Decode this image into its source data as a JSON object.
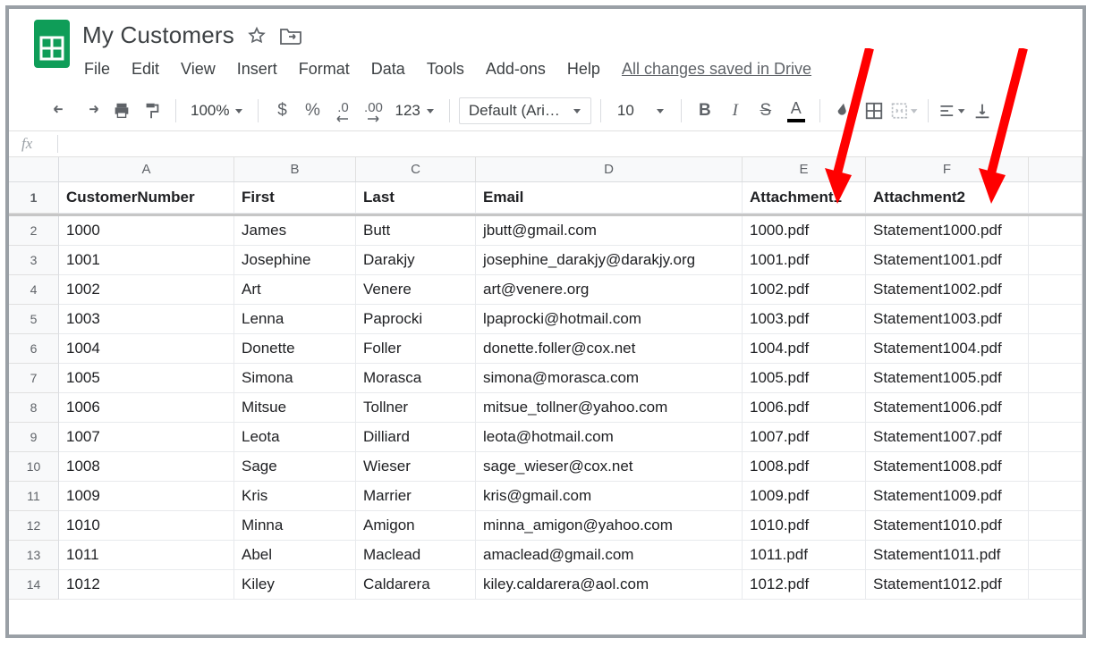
{
  "doc": {
    "title": "My Customers",
    "saved_text": "All changes saved in Drive"
  },
  "menu": {
    "file": "File",
    "edit": "Edit",
    "view": "View",
    "insert": "Insert",
    "format": "Format",
    "data": "Data",
    "tools": "Tools",
    "addons": "Add-ons",
    "help": "Help"
  },
  "toolbar": {
    "zoom": "100%",
    "currency": "$",
    "percent": "%",
    "dec_dec": ".0",
    "inc_dec": ".00",
    "num_format": "123",
    "font_name": "Default (Ari…",
    "font_size": "10"
  },
  "formula": {
    "fx": "fx"
  },
  "columns": [
    "A",
    "B",
    "C",
    "D",
    "E",
    "F",
    ""
  ],
  "headers": {
    "A": "CustomerNumber",
    "B": "First",
    "C": "Last",
    "D": "Email",
    "E": "Attachment1",
    "F": "Attachment2"
  },
  "rows": [
    {
      "n": "2",
      "A": "1000",
      "B": "James",
      "C": "Butt",
      "D": "jbutt@gmail.com",
      "E": "1000.pdf",
      "F": "Statement1000.pdf"
    },
    {
      "n": "3",
      "A": "1001",
      "B": "Josephine",
      "C": "Darakjy",
      "D": "josephine_darakjy@darakjy.org",
      "E": "1001.pdf",
      "F": "Statement1001.pdf"
    },
    {
      "n": "4",
      "A": "1002",
      "B": "Art",
      "C": "Venere",
      "D": "art@venere.org",
      "E": "1002.pdf",
      "F": "Statement1002.pdf"
    },
    {
      "n": "5",
      "A": "1003",
      "B": "Lenna",
      "C": "Paprocki",
      "D": "lpaprocki@hotmail.com",
      "E": "1003.pdf",
      "F": "Statement1003.pdf"
    },
    {
      "n": "6",
      "A": "1004",
      "B": "Donette",
      "C": "Foller",
      "D": "donette.foller@cox.net",
      "E": "1004.pdf",
      "F": "Statement1004.pdf"
    },
    {
      "n": "7",
      "A": "1005",
      "B": "Simona",
      "C": "Morasca",
      "D": "simona@morasca.com",
      "E": "1005.pdf",
      "F": "Statement1005.pdf"
    },
    {
      "n": "8",
      "A": "1006",
      "B": "Mitsue",
      "C": "Tollner",
      "D": "mitsue_tollner@yahoo.com",
      "E": "1006.pdf",
      "F": "Statement1006.pdf"
    },
    {
      "n": "9",
      "A": "1007",
      "B": "Leota",
      "C": "Dilliard",
      "D": "leota@hotmail.com",
      "E": "1007.pdf",
      "F": "Statement1007.pdf"
    },
    {
      "n": "10",
      "A": "1008",
      "B": "Sage",
      "C": "Wieser",
      "D": "sage_wieser@cox.net",
      "E": "1008.pdf",
      "F": "Statement1008.pdf"
    },
    {
      "n": "11",
      "A": "1009",
      "B": "Kris",
      "C": "Marrier",
      "D": "kris@gmail.com",
      "E": "1009.pdf",
      "F": "Statement1009.pdf"
    },
    {
      "n": "12",
      "A": "1010",
      "B": "Minna",
      "C": "Amigon",
      "D": "minna_amigon@yahoo.com",
      "E": "1010.pdf",
      "F": "Statement1010.pdf"
    },
    {
      "n": "13",
      "A": "1011",
      "B": "Abel",
      "C": "Maclead",
      "D": "amaclead@gmail.com",
      "E": "1011.pdf",
      "F": "Statement1011.pdf"
    },
    {
      "n": "14",
      "A": "1012",
      "B": "Kiley",
      "C": "Caldarera",
      "D": "kiley.caldarera@aol.com",
      "E": "1012.pdf",
      "F": "Statement1012.pdf"
    }
  ]
}
